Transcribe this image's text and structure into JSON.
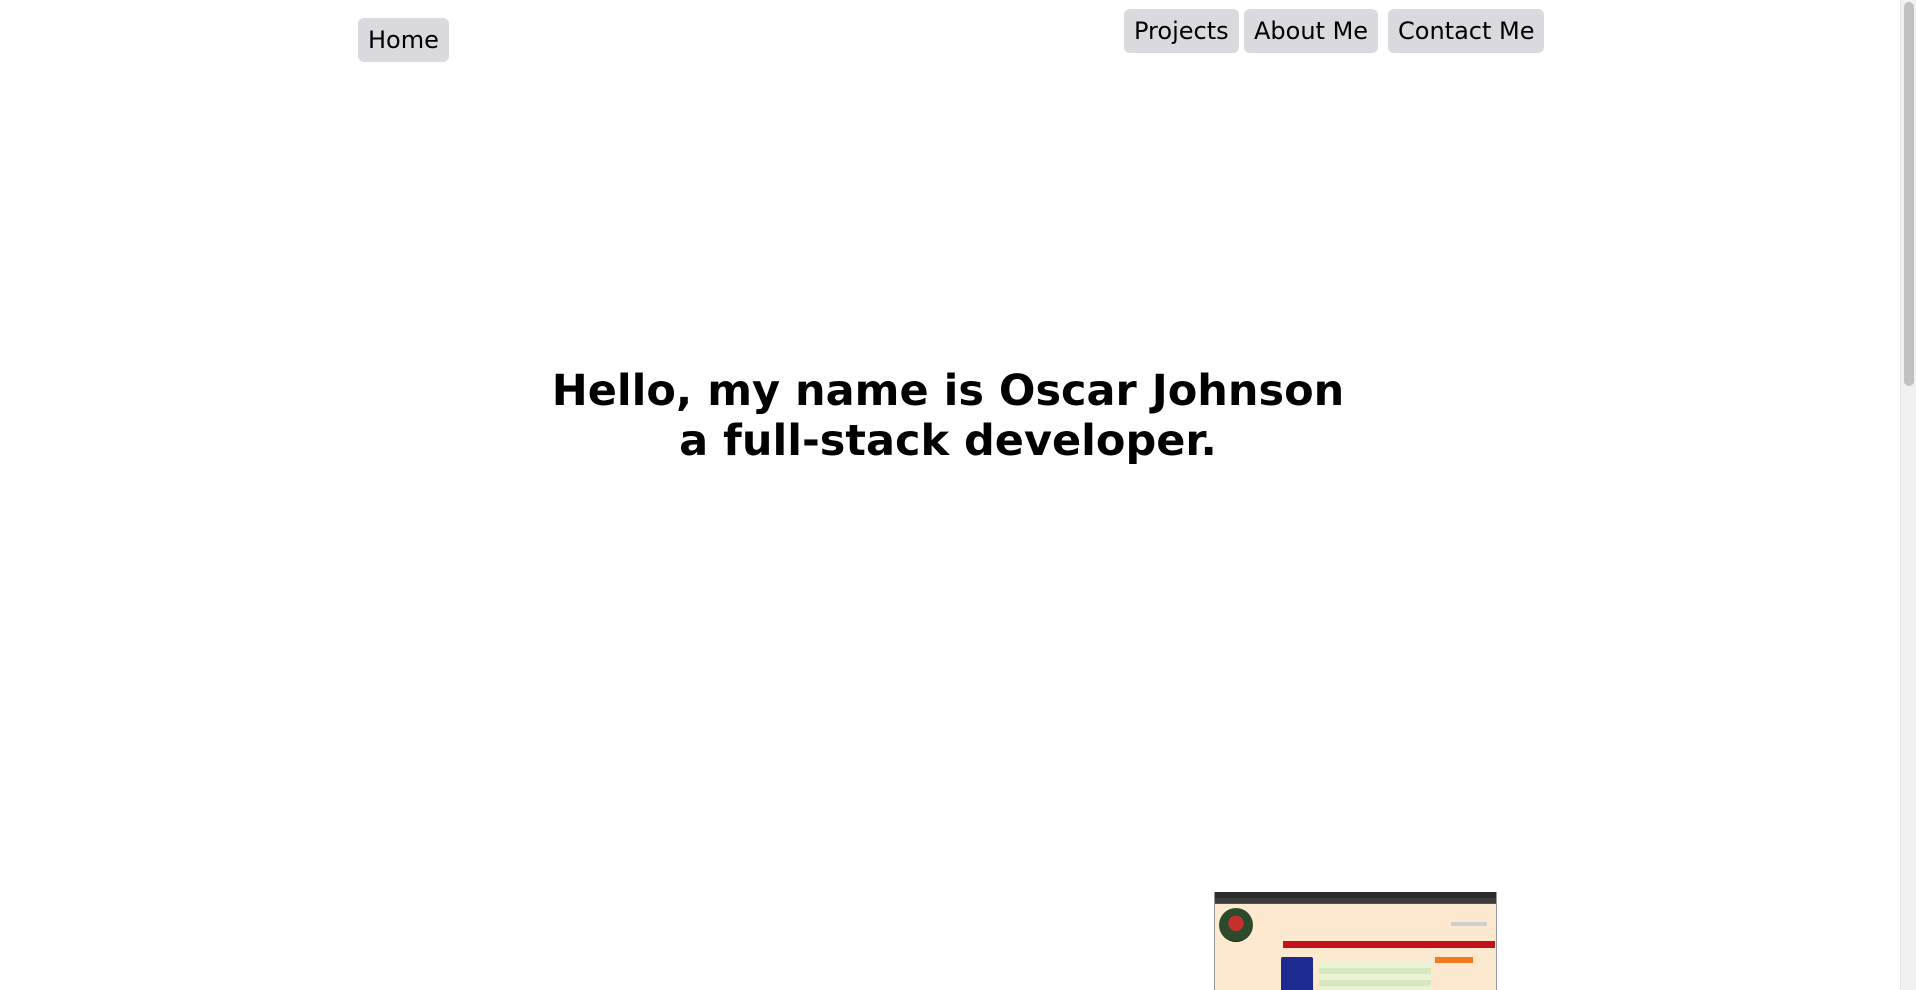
{
  "nav": {
    "home_label": "Home",
    "projects_label": "Projects",
    "about_label": "About Me",
    "contact_label": "Contact Me"
  },
  "hero": {
    "line1": "Hello, my name is Oscar Johnson",
    "line2": "a full-stack developer."
  },
  "colors": {
    "nav_button_bg": "#d9d9de",
    "page_bg": "#ffffff",
    "text": "#000000"
  },
  "scrollbar": {
    "position_fraction": 0.0
  }
}
